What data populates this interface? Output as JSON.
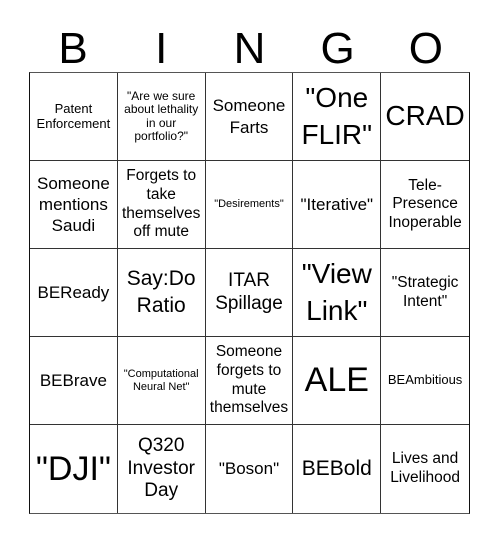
{
  "header": {
    "letters": [
      "B",
      "I",
      "N",
      "G",
      "O"
    ]
  },
  "cells": [
    "Patent Enforcement",
    "\"Are we sure about lethality in our portfolio?\"",
    "Someone Farts",
    "\"One FLIR\"",
    "CRAD",
    "Someone mentions Saudi",
    "Forgets to take themselves off mute",
    "\"Desirements\"",
    "\"Iterative\"",
    "Tele-Presence Inoperable",
    "BEReady",
    "Say:Do Ratio",
    "ITAR Spillage",
    "\"View Link\"",
    "\"Strategic Intent\"",
    "BEBrave",
    "\"Computational Neural Net\"",
    "Someone forgets to mute themselves",
    "ALE",
    "BEAmbitious",
    "\"DJI\"",
    "Q320 Investor Day",
    "\"Boson\"",
    "BEBold",
    "Lives and Livelihood"
  ]
}
